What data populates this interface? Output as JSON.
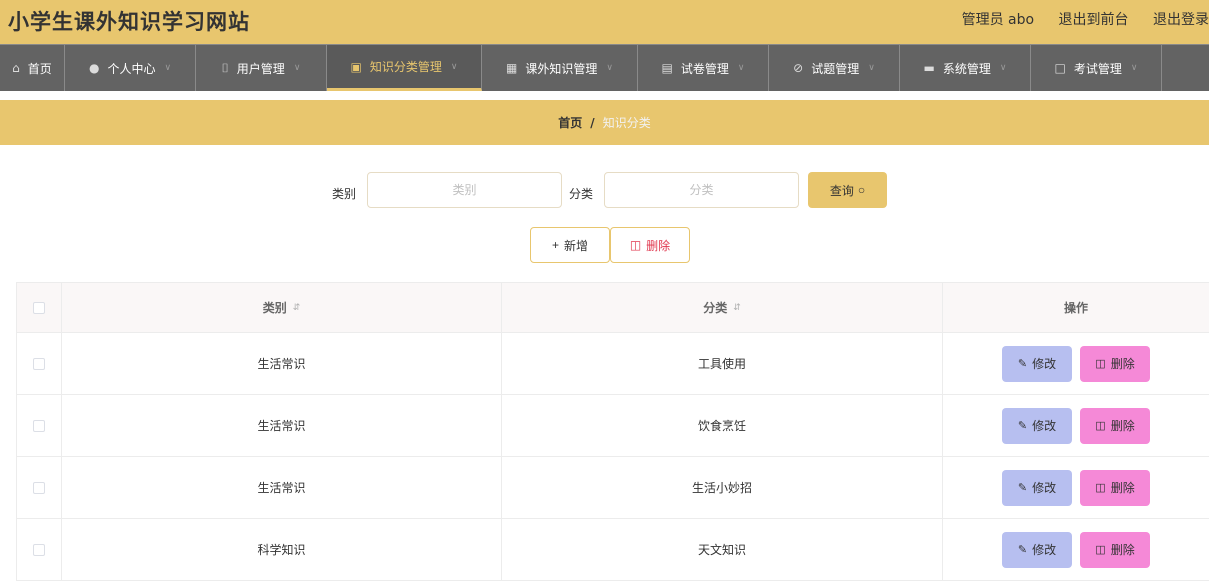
{
  "header": {
    "title": "小学生课外知识学习网站",
    "user_label": "管理员 abo",
    "front_link": "退出到前台",
    "logout_link": "退出登录"
  },
  "nav": {
    "items": [
      {
        "label": "首页",
        "icon": "home-icon"
      },
      {
        "label": "个人中心",
        "icon": "person-icon"
      },
      {
        "label": "用户管理",
        "icon": "microphone-icon"
      },
      {
        "label": "知识分类管理",
        "icon": "chat-icon"
      },
      {
        "label": "课外知识管理",
        "icon": "document-icon"
      },
      {
        "label": "试卷管理",
        "icon": "clipboard-icon"
      },
      {
        "label": "试题管理",
        "icon": "bell-off-icon"
      },
      {
        "label": "系统管理",
        "icon": "briefcase-icon"
      },
      {
        "label": "考试管理",
        "icon": "message-icon"
      }
    ],
    "active": "知识分类管理"
  },
  "breadcrumb": {
    "home": "首页",
    "separator": "/",
    "current": "知识分类"
  },
  "search": {
    "category_label": "类别",
    "category_placeholder": "类别",
    "subcategory_label": "分类",
    "subcategory_placeholder": "分类",
    "query_label": "查询"
  },
  "actions": {
    "add_label": "新增",
    "delete_label": "删除"
  },
  "table": {
    "columns": {
      "category": "类别",
      "subcategory": "分类",
      "operations": "操作"
    },
    "rows": [
      {
        "category": "生活常识",
        "subcategory": "工具使用"
      },
      {
        "category": "生活常识",
        "subcategory": "饮食烹饪"
      },
      {
        "category": "生活常识",
        "subcategory": "生活小妙招"
      },
      {
        "category": "科学知识",
        "subcategory": "天文知识"
      }
    ],
    "edit_label": "修改",
    "delete_label": "删除"
  },
  "colors": {
    "accent": "#e8c66e",
    "nav_bg": "#636363",
    "edit_button": "#b7bff0",
    "delete_button": "#f589d7",
    "danger_text": "#e0384f"
  }
}
